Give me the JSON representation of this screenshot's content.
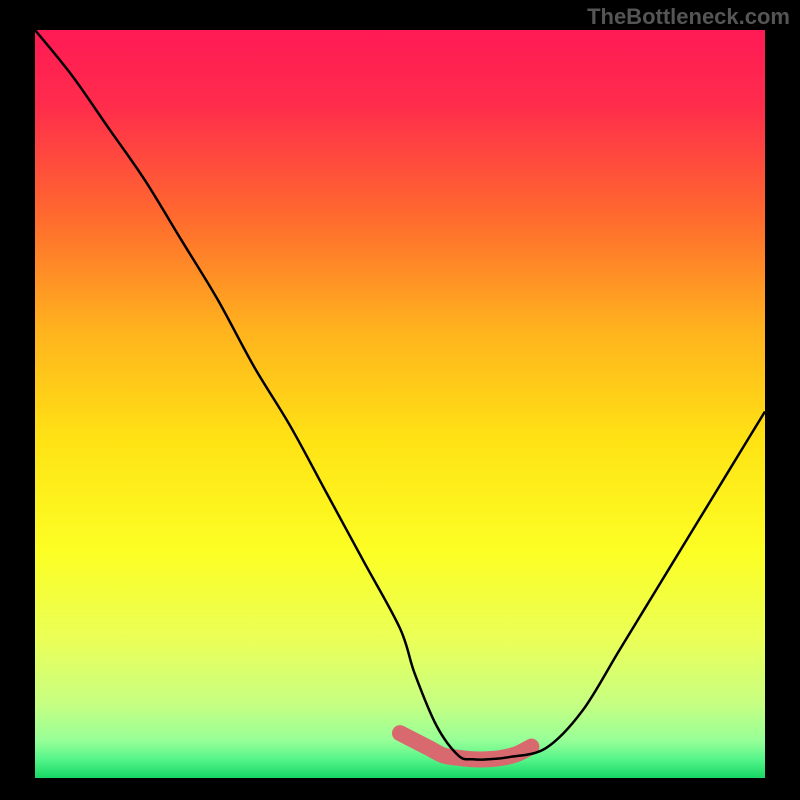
{
  "watermark": "TheBottleneck.com",
  "colors": {
    "gradient_stops": [
      {
        "offset": 0.0,
        "color": "#ff1a55"
      },
      {
        "offset": 0.1,
        "color": "#ff2c4c"
      },
      {
        "offset": 0.25,
        "color": "#ff6a2e"
      },
      {
        "offset": 0.4,
        "color": "#ffb21e"
      },
      {
        "offset": 0.55,
        "color": "#ffe314"
      },
      {
        "offset": 0.7,
        "color": "#fcff25"
      },
      {
        "offset": 0.82,
        "color": "#e9ff5a"
      },
      {
        "offset": 0.9,
        "color": "#c7ff82"
      },
      {
        "offset": 0.95,
        "color": "#97ff97"
      },
      {
        "offset": 0.975,
        "color": "#55f58a"
      },
      {
        "offset": 1.0,
        "color": "#16d864"
      }
    ],
    "highlight": "#d86a6f",
    "curve": "#000000",
    "frame": "#000000"
  },
  "chart_data": {
    "type": "line",
    "title": "",
    "xlabel": "",
    "ylabel": "",
    "xlim": [
      0,
      100
    ],
    "ylim": [
      0,
      100
    ],
    "series": [
      {
        "name": "bottleneck-curve",
        "x": [
          0,
          5,
          10,
          15,
          20,
          25,
          30,
          35,
          40,
          45,
          50,
          52,
          55,
          58,
          60,
          62,
          65,
          70,
          75,
          80,
          85,
          90,
          95,
          100
        ],
        "y": [
          100,
          94,
          87,
          80,
          72,
          64,
          55,
          47,
          38,
          29,
          20,
          14,
          7,
          3,
          2.5,
          2.5,
          2.8,
          4,
          9,
          17,
          25,
          33,
          41,
          49
        ]
      }
    ],
    "highlight_segment": {
      "note": "thick salmon band near the minimum, roughly x=50..68, y≈2–6",
      "points": [
        {
          "x": 50,
          "y": 6
        },
        {
          "x": 52,
          "y": 5
        },
        {
          "x": 54,
          "y": 4
        },
        {
          "x": 56,
          "y": 3
        },
        {
          "x": 58,
          "y": 2.7
        },
        {
          "x": 60,
          "y": 2.5
        },
        {
          "x": 62,
          "y": 2.5
        },
        {
          "x": 64,
          "y": 2.7
        },
        {
          "x": 66,
          "y": 3.2
        },
        {
          "x": 68,
          "y": 4.2
        }
      ],
      "stroke_width_px": 16
    }
  }
}
